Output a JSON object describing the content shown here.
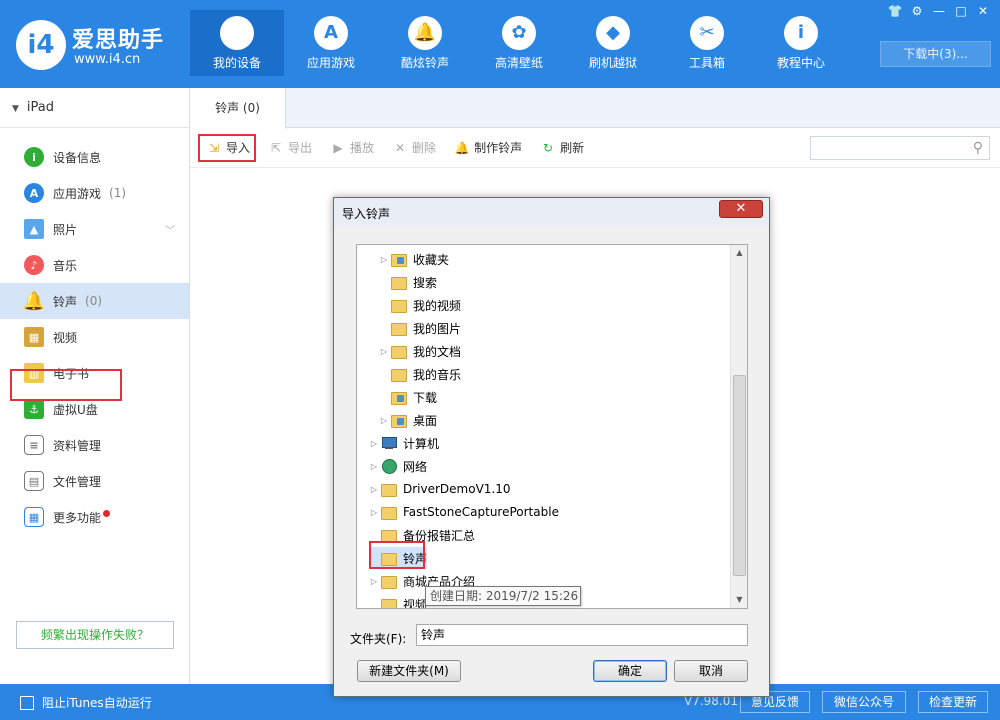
{
  "app": {
    "logo_mark": "i4",
    "logo_title": "爱思助手",
    "logo_url": "www.i4.cn",
    "download_label": "下载中(3)...",
    "nav": [
      {
        "label": "我的设备",
        "icon": "apple-icon",
        "glyph": ""
      },
      {
        "label": "应用游戏",
        "icon": "app-store-icon",
        "glyph": "A"
      },
      {
        "label": "酷炫铃声",
        "icon": "bell-icon",
        "glyph": "🔔"
      },
      {
        "label": "高清壁纸",
        "icon": "flower-icon",
        "glyph": "✿"
      },
      {
        "label": "刷机越狱",
        "icon": "dropbox-icon",
        "glyph": "◆"
      },
      {
        "label": "工具箱",
        "icon": "tools-icon",
        "glyph": "✂"
      },
      {
        "label": "教程中心",
        "icon": "info-icon",
        "glyph": "i"
      }
    ],
    "window_buttons": [
      "👕",
      "⚙",
      "—",
      "□",
      "✕"
    ]
  },
  "sidebar": {
    "device": "iPad",
    "items": [
      {
        "label": "设备信息",
        "count": "",
        "icon": "info-icon",
        "glyph": "i"
      },
      {
        "label": "应用游戏",
        "count": "(1)",
        "icon": "app-store-icon",
        "glyph": "A"
      },
      {
        "label": "照片",
        "count": "",
        "icon": "photo-icon",
        "glyph": "▲"
      },
      {
        "label": "音乐",
        "count": "",
        "icon": "music-icon",
        "glyph": "♪"
      },
      {
        "label": "铃声",
        "count": "(0)",
        "icon": "bell-icon",
        "glyph": "🔔"
      },
      {
        "label": "视频",
        "count": "",
        "icon": "film-icon",
        "glyph": "▦"
      },
      {
        "label": "电子书",
        "count": "",
        "icon": "book-icon",
        "glyph": "▥"
      },
      {
        "label": "虚拟U盘",
        "count": "",
        "icon": "usb-icon",
        "glyph": "⚓"
      },
      {
        "label": "资料管理",
        "count": "",
        "icon": "contacts-icon",
        "glyph": "≡"
      },
      {
        "label": "文件管理",
        "count": "",
        "icon": "file-icon",
        "glyph": "▤"
      },
      {
        "label": "更多功能",
        "count": "",
        "icon": "more-icon",
        "glyph": "▦"
      }
    ],
    "help_label": "频繁出现操作失败？"
  },
  "main": {
    "tab_label": "铃声 (0)",
    "toolbar": [
      {
        "label": "导入",
        "enabled": true,
        "icon": "import-icon",
        "glyph": "⇲",
        "color": "#e8a317"
      },
      {
        "label": "导出",
        "enabled": false,
        "icon": "export-icon",
        "glyph": "⇱",
        "color": "#aaaaaa"
      },
      {
        "label": "播放",
        "enabled": false,
        "icon": "play-icon",
        "glyph": "▶",
        "color": "#aaaaaa"
      },
      {
        "label": "删除",
        "enabled": false,
        "icon": "delete-icon",
        "glyph": "✕",
        "color": "#aaaaaa"
      },
      {
        "label": "制作铃声",
        "enabled": true,
        "icon": "make-ringtone-icon",
        "glyph": "🔔",
        "color": "#2b86e3"
      },
      {
        "label": "刷新",
        "enabled": true,
        "icon": "refresh-icon",
        "glyph": "↻",
        "color": "#2eae35"
      }
    ]
  },
  "footer": {
    "itunes_label": "阻止iTunes自动运行",
    "version": "V7.98.01",
    "feedback": "意见反馈",
    "wechat": "微信公众号",
    "update": "检查更新"
  },
  "dialog": {
    "title": "导入铃声",
    "tree": [
      {
        "label": "收藏夹",
        "expand": "▷",
        "kind": "folder-star"
      },
      {
        "label": "搜索",
        "expand": "",
        "kind": "folder"
      },
      {
        "label": "我的视频",
        "expand": "",
        "kind": "folder"
      },
      {
        "label": "我的图片",
        "expand": "",
        "kind": "folder"
      },
      {
        "label": "我的文档",
        "expand": "▷",
        "kind": "folder"
      },
      {
        "label": "我的音乐",
        "expand": "",
        "kind": "folder"
      },
      {
        "label": "下载",
        "expand": "",
        "kind": "folder-dl"
      },
      {
        "label": "桌面",
        "expand": "▷",
        "kind": "folder-desk"
      },
      {
        "label": "计算机",
        "expand": "▷",
        "kind": "pc"
      },
      {
        "label": "网络",
        "expand": "▷",
        "kind": "globe"
      },
      {
        "label": "DriverDemoV1.10",
        "expand": "▷",
        "kind": "folder"
      },
      {
        "label": "FastStoneCapturePortable",
        "expand": "▷",
        "kind": "folder"
      },
      {
        "label": "备份报错汇总",
        "expand": "",
        "kind": "folder"
      },
      {
        "label": "铃声",
        "expand": "",
        "kind": "folder",
        "selected": true
      },
      {
        "label": "商城产品介绍",
        "expand": "▷",
        "kind": "folder"
      },
      {
        "label": "视频",
        "expand": "",
        "kind": "folder"
      }
    ],
    "tooltip": "创建日期: 2019/7/2 15:26",
    "folder_label": "文件夹(F):",
    "folder_value": "铃声",
    "new_folder": "新建文件夹(M)",
    "ok": "确定",
    "cancel": "取消"
  }
}
